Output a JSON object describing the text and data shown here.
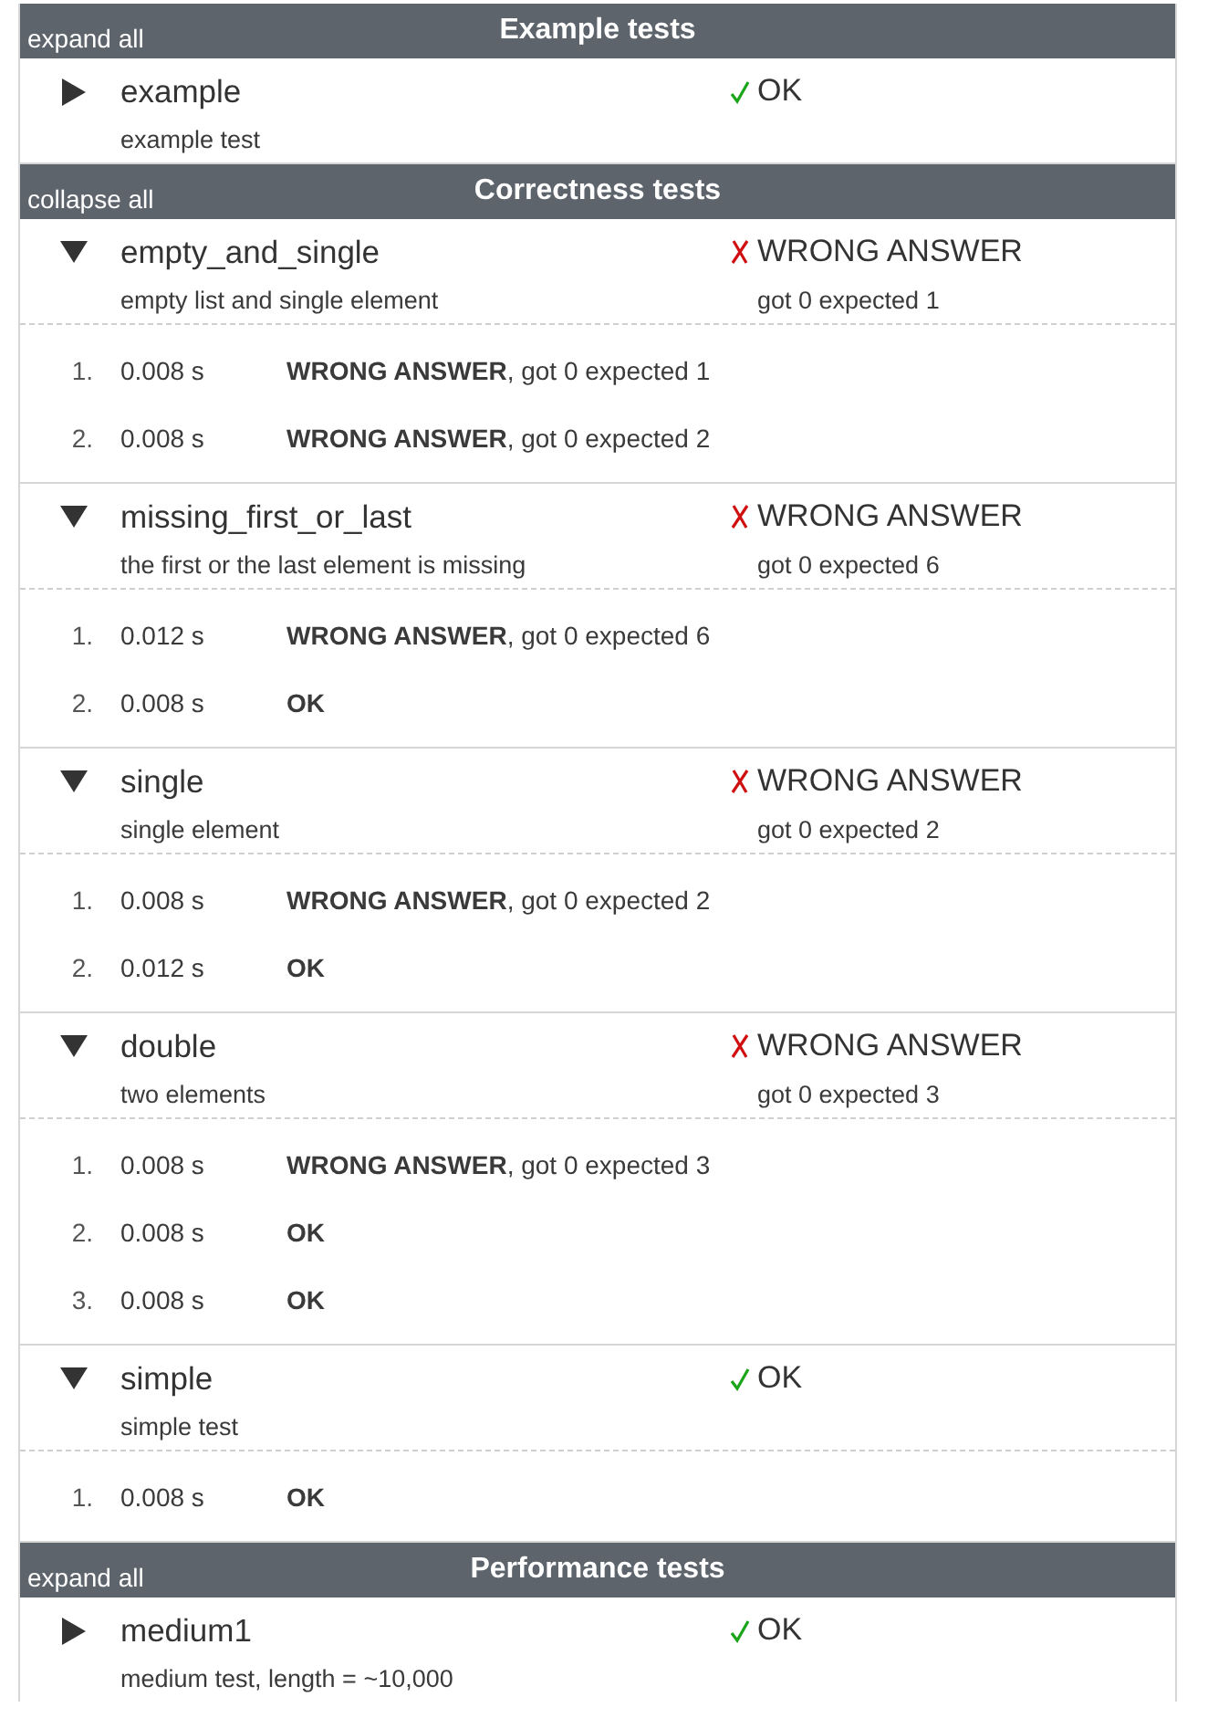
{
  "sections": [
    {
      "toggle": "expand all",
      "title": "Example tests",
      "tests": [
        {
          "name": "example",
          "description": "example test",
          "expanded": false,
          "status": {
            "kind": "ok",
            "text": "OK"
          }
        }
      ]
    },
    {
      "toggle": "collapse all",
      "title": "Correctness tests",
      "tests": [
        {
          "name": "empty_and_single",
          "description": "empty list and single element",
          "expanded": true,
          "status": {
            "kind": "wrong",
            "text": "WRONG ANSWER",
            "detail": "got 0 expected 1"
          },
          "runs": [
            {
              "number": "1.",
              "time": "0.008 s",
              "result": "**WRONG ANSWER**, got 0 expected 1"
            },
            {
              "number": "2.",
              "time": "0.008 s",
              "result": "**WRONG ANSWER**, got 0 expected 2"
            }
          ]
        },
        {
          "name": "missing_first_or_last",
          "description": "the first or the last element is missing",
          "expanded": true,
          "status": {
            "kind": "wrong",
            "text": "WRONG ANSWER",
            "detail": "got 0 expected 6"
          },
          "runs": [
            {
              "number": "1.",
              "time": "0.012 s",
              "result": "**WRONG ANSWER**, got 0 expected 6"
            },
            {
              "number": "2.",
              "time": "0.008 s",
              "result": "**OK**"
            }
          ]
        },
        {
          "name": "single",
          "description": "single element",
          "expanded": true,
          "status": {
            "kind": "wrong",
            "text": "WRONG ANSWER",
            "detail": "got 0 expected 2"
          },
          "runs": [
            {
              "number": "1.",
              "time": "0.008 s",
              "result": "**WRONG ANSWER**, got 0 expected 2"
            },
            {
              "number": "2.",
              "time": "0.012 s",
              "result": "**OK**"
            }
          ]
        },
        {
          "name": "double",
          "description": "two elements",
          "expanded": true,
          "status": {
            "kind": "wrong",
            "text": "WRONG ANSWER",
            "detail": "got 0 expected 3"
          },
          "runs": [
            {
              "number": "1.",
              "time": "0.008 s",
              "result": "**WRONG ANSWER**, got 0 expected 3"
            },
            {
              "number": "2.",
              "time": "0.008 s",
              "result": "**OK**"
            },
            {
              "number": "3.",
              "time": "0.008 s",
              "result": "**OK**"
            }
          ]
        },
        {
          "name": "simple",
          "description": "simple test",
          "expanded": true,
          "status": {
            "kind": "ok",
            "text": "OK"
          },
          "runs": [
            {
              "number": "1.",
              "time": "0.008 s",
              "result": "**OK**"
            }
          ]
        }
      ]
    },
    {
      "toggle": "expand all",
      "title": "Performance tests",
      "tests": [
        {
          "name": "medium1",
          "description": "medium test, length = ~10,000",
          "expanded": false,
          "status": {
            "kind": "ok",
            "text": "OK"
          }
        }
      ]
    }
  ]
}
